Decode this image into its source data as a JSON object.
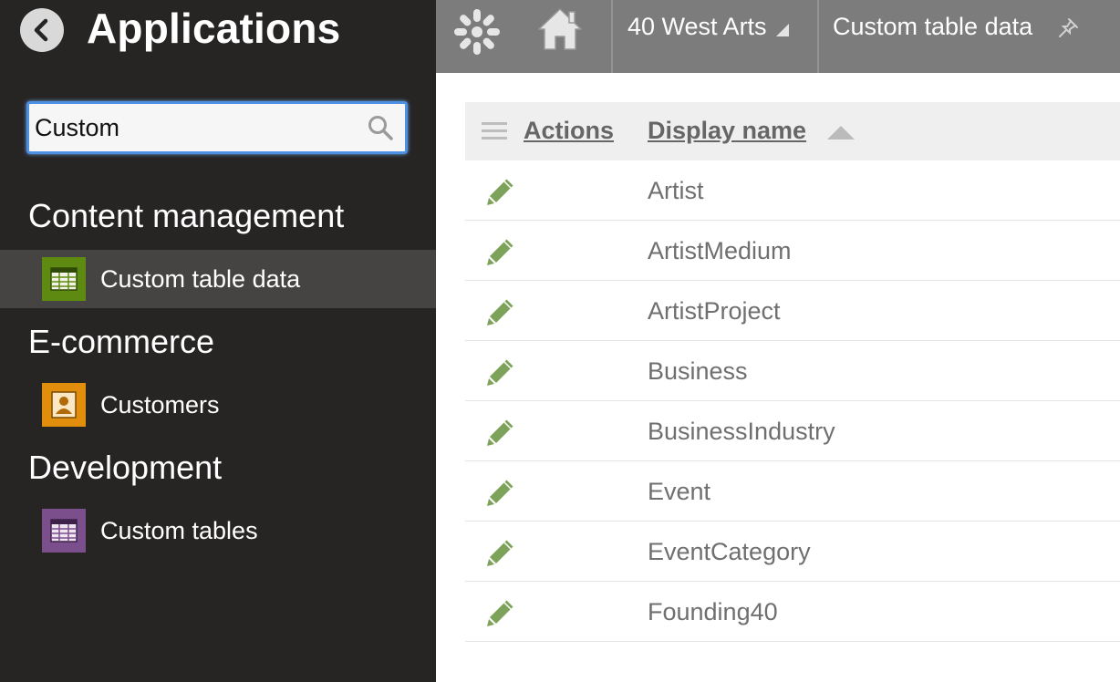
{
  "sidebar": {
    "title": "Applications",
    "search": {
      "value": "Custom",
      "placeholder": ""
    },
    "categories": [
      {
        "heading": "Content management",
        "items": [
          {
            "label": "Custom table data",
            "icon": "table-icon",
            "color": "#5e8a12",
            "selected": true
          }
        ]
      },
      {
        "heading": "E-commerce",
        "items": [
          {
            "label": "Customers",
            "icon": "customer-card-icon",
            "color": "#e08e0b",
            "selected": false
          }
        ]
      },
      {
        "heading": "Development",
        "items": [
          {
            "label": "Custom tables",
            "icon": "table-icon",
            "color": "#7b4f8c",
            "selected": false
          }
        ]
      }
    ]
  },
  "topbar": {
    "site_name": "40 West Arts",
    "current_app": "Custom table data"
  },
  "grid": {
    "headers": {
      "actions": "Actions",
      "display_name": "Display name"
    },
    "sort": "ascending",
    "rows": [
      {
        "display_name": "Artist"
      },
      {
        "display_name": "ArtistMedium"
      },
      {
        "display_name": "ArtistProject"
      },
      {
        "display_name": "Business"
      },
      {
        "display_name": "BusinessIndustry"
      },
      {
        "display_name": "Event"
      },
      {
        "display_name": "EventCategory"
      },
      {
        "display_name": "Founding40"
      }
    ]
  },
  "colors": {
    "sidebar_bg": "#262524",
    "topbar_bg": "#7c7c7c",
    "edit_icon": "#7da35a",
    "search_focus": "#4d8fe0"
  }
}
